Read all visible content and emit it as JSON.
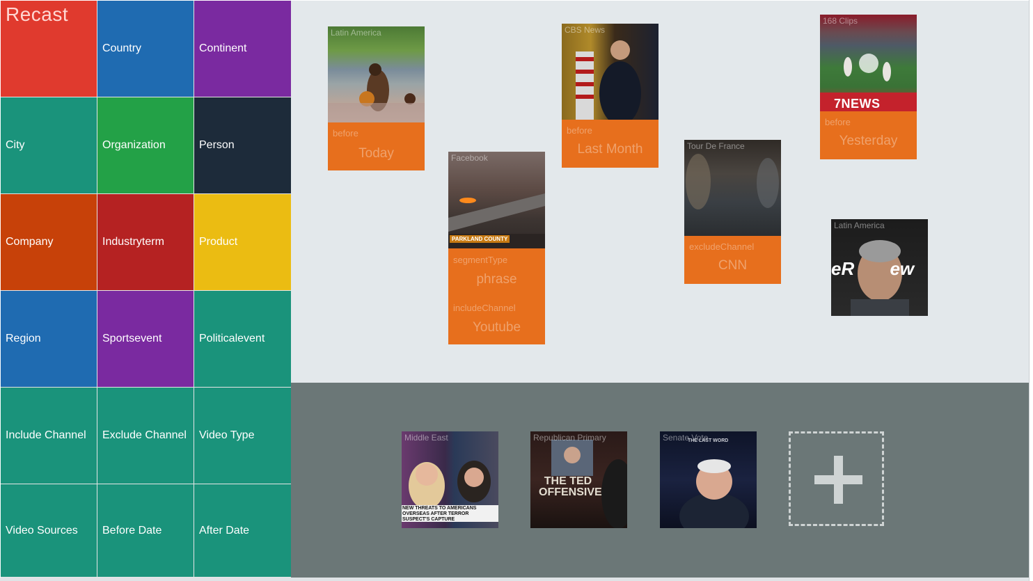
{
  "app": {
    "title": "Recast"
  },
  "tiles": [
    {
      "label": "",
      "color": "#e03a2e"
    },
    {
      "label": "Country",
      "color": "#1f6bb1"
    },
    {
      "label": "Continent",
      "color": "#7a2aa0"
    },
    {
      "label": "City",
      "color": "#1a937b"
    },
    {
      "label": "Organization",
      "color": "#23a147"
    },
    {
      "label": "Person",
      "color": "#1d2b3a"
    },
    {
      "label": "Company",
      "color": "#c74109"
    },
    {
      "label": "Industryterm",
      "color": "#b52222"
    },
    {
      "label": "Product",
      "color": "#ebbc12"
    },
    {
      "label": "Region",
      "color": "#1f6bb1"
    },
    {
      "label": "Sportsevent",
      "color": "#7a2aa0"
    },
    {
      "label": "Politicalevent",
      "color": "#1a937b"
    },
    {
      "label": "Include Channel",
      "color": "#1a937b"
    },
    {
      "label": "Exclude Channel",
      "color": "#1a937b"
    },
    {
      "label": "Video Type",
      "color": "#1a937b"
    },
    {
      "label": "Video Sources",
      "color": "#1a937b"
    },
    {
      "label": "Before Date",
      "color": "#1a937b"
    },
    {
      "label": "After Date",
      "color": "#1a937b"
    }
  ],
  "canvas_cards": [
    {
      "caption": "Latin America",
      "filters": [
        {
          "key": "before",
          "value": "Today"
        }
      ]
    },
    {
      "caption": "Facebook",
      "overlay": "PARKLAND COUNTY",
      "filters": [
        {
          "key": "segmentType",
          "value": "phrase"
        },
        {
          "key": "includeChannel",
          "value": "Youtube"
        }
      ]
    },
    {
      "caption": "CBS News",
      "filters": [
        {
          "key": "before",
          "value": "Last Month"
        }
      ]
    },
    {
      "caption": "Tour De France",
      "filters": [
        {
          "key": "excludeChannel",
          "value": "CNN"
        }
      ]
    },
    {
      "caption": "168 Clips",
      "overlay": "7NEWS",
      "filters": [
        {
          "key": "before",
          "value": "Yesterday"
        }
      ]
    },
    {
      "caption": "Latin America",
      "overlay": "eR ew",
      "filters": []
    }
  ],
  "tray_cards": [
    {
      "caption": "Middle East",
      "overlay": "NEW THREATS TO AMERICANS OVERSEAS AFTER TERROR SUSPECT'S CAPTURE"
    },
    {
      "caption": "Republican Primary",
      "overlay": "THE TED OFFENSIVE"
    },
    {
      "caption": "Senate Vote",
      "overlay": "THE LAST WORD"
    }
  ],
  "add_button": {
    "icon": "plus-icon"
  }
}
